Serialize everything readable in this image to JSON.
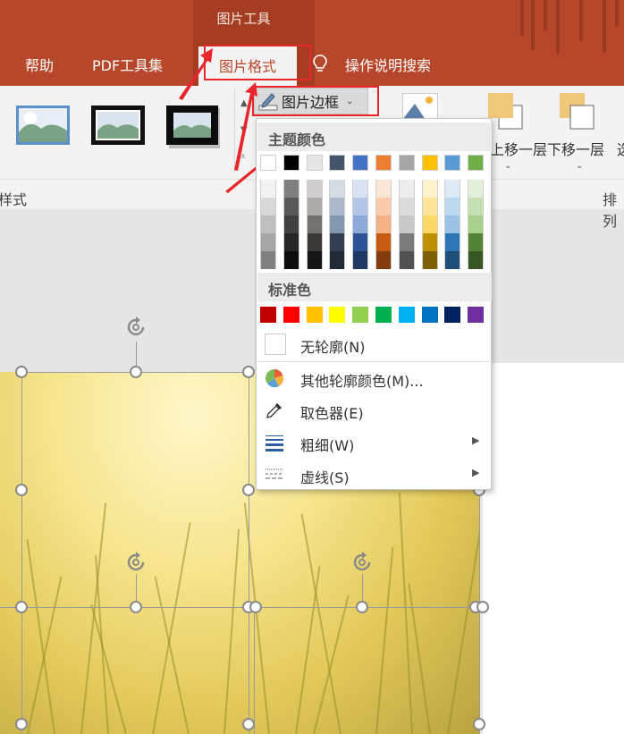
{
  "titlebar": {
    "context_label": "图片工具"
  },
  "tabs": [
    {
      "label": "帮助"
    },
    {
      "label": "PDF工具集"
    },
    {
      "label": "图片格式",
      "active": true
    },
    {
      "label": "操作说明搜索"
    }
  ],
  "ribbon": {
    "border_button_label": "图片边框",
    "bring_forward_label": "上移一层",
    "send_backward_label": "下移一层",
    "group_style_label": "样式",
    "group_arrange_label": "排列"
  },
  "menu": {
    "theme_header": "主题颜色",
    "standard_header": "标准色",
    "no_outline": "无轮廓(N)",
    "more_colors": "其他轮廓颜色(M)...",
    "eyedropper": "取色器(E)",
    "weight": "粗细(W)",
    "dashes": "虚线(S)",
    "theme_colors": [
      [
        "#ffffff",
        "#f2f2f2",
        "#d9d9d9",
        "#bfbfbf",
        "#a6a6a6",
        "#808080"
      ],
      [
        "#000000",
        "#7f7f7f",
        "#595959",
        "#404040",
        "#262626",
        "#0d0d0d"
      ],
      [
        "#e7e6e6",
        "#d0cece",
        "#aeaaaa",
        "#757171",
        "#3b3838",
        "#171616"
      ],
      [
        "#44546a",
        "#d6dce4",
        "#adb9ca",
        "#8497b0",
        "#333f50",
        "#222a35"
      ],
      [
        "#4472c4",
        "#d9e2f3",
        "#b4c6e7",
        "#8eaadb",
        "#2f5496",
        "#1f3864"
      ],
      [
        "#ed7d31",
        "#fbe5d5",
        "#f7cbac",
        "#f4b183",
        "#c55a11",
        "#833c0b"
      ],
      [
        "#a5a5a5",
        "#ededed",
        "#dbdbdb",
        "#c9c9c9",
        "#7b7b7b",
        "#525252"
      ],
      [
        "#ffc000",
        "#fff2cc",
        "#fee599",
        "#ffd965",
        "#bf9000",
        "#7f6000"
      ],
      [
        "#5b9bd5",
        "#deebf6",
        "#bdd7ee",
        "#9cc3e5",
        "#2e75b5",
        "#1f4e79"
      ],
      [
        "#70ad47",
        "#e2efd9",
        "#c5e0b3",
        "#a8d08d",
        "#538135",
        "#375623"
      ]
    ],
    "standard_colors": [
      "#c00000",
      "#ff0000",
      "#ffc000",
      "#ffff00",
      "#92d050",
      "#00b050",
      "#00b0f0",
      "#0070c0",
      "#002060",
      "#7030a0"
    ]
  },
  "colors": {
    "accent": "#b7472a",
    "highlight": "#e8262b"
  }
}
